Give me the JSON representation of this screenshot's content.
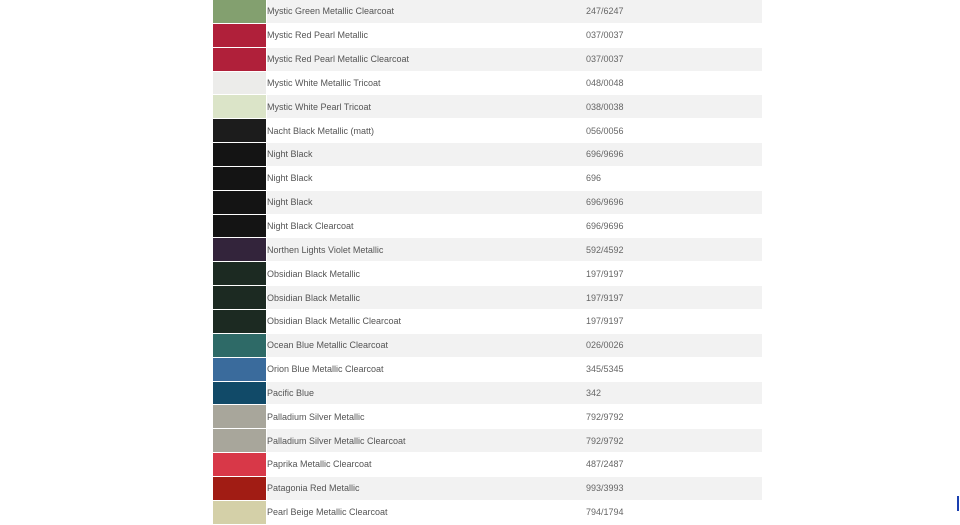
{
  "colors": [
    {
      "name": "Mystic Green Metallic Clearcoat",
      "code": "247/6247",
      "swatch": "#83a06f"
    },
    {
      "name": "Mystic Red Pearl Metallic",
      "code": "037/0037",
      "swatch": "#b0203a"
    },
    {
      "name": "Mystic Red Pearl Metallic Clearcoat",
      "code": "037/0037",
      "swatch": "#b0203a"
    },
    {
      "name": "Mystic White Metallic Tricoat",
      "code": "048/0048",
      "swatch": "#ececea"
    },
    {
      "name": "Mystic White Pearl Tricoat",
      "code": "038/0038",
      "swatch": "#dbe4c8"
    },
    {
      "name": "Nacht Black Metallic (matt)",
      "code": "056/0056",
      "swatch": "#1c1c1c"
    },
    {
      "name": "Night Black",
      "code": "696/9696",
      "swatch": "#141414"
    },
    {
      "name": "Night Black",
      "code": "696",
      "swatch": "#141414"
    },
    {
      "name": "Night Black",
      "code": "696/9696",
      "swatch": "#141414"
    },
    {
      "name": "Night Black Clearcoat",
      "code": "696/9696",
      "swatch": "#141414"
    },
    {
      "name": "Northen Lights Violet Metallic",
      "code": "592/4592",
      "swatch": "#33243b"
    },
    {
      "name": "Obsidian Black Metallic",
      "code": "197/9197",
      "swatch": "#1c2a22"
    },
    {
      "name": "Obsidian Black Metallic",
      "code": "197/9197",
      "swatch": "#1c2a22"
    },
    {
      "name": "Obsidian Black Metallic Clearcoat",
      "code": "197/9197",
      "swatch": "#1c2a22"
    },
    {
      "name": "Ocean Blue Metallic Clearcoat",
      "code": "026/0026",
      "swatch": "#2e6a67"
    },
    {
      "name": "Orion Blue Metallic Clearcoat",
      "code": "345/5345",
      "swatch": "#3a6b9c"
    },
    {
      "name": "Pacific Blue",
      "code": "342",
      "swatch": "#114a68"
    },
    {
      "name": "Palladium Silver Metallic",
      "code": "792/9792",
      "swatch": "#a8a69b"
    },
    {
      "name": "Palladium Silver Metallic Clearcoat",
      "code": "792/9792",
      "swatch": "#a8a69b"
    },
    {
      "name": "Paprika Metallic Clearcoat",
      "code": "487/2487",
      "swatch": "#d83848"
    },
    {
      "name": "Patagonia Red Metallic",
      "code": "993/3993",
      "swatch": "#a11c14"
    },
    {
      "name": "Pearl Beige Metallic Clearcoat",
      "code": "794/1794",
      "swatch": "#d4d0a8"
    }
  ]
}
